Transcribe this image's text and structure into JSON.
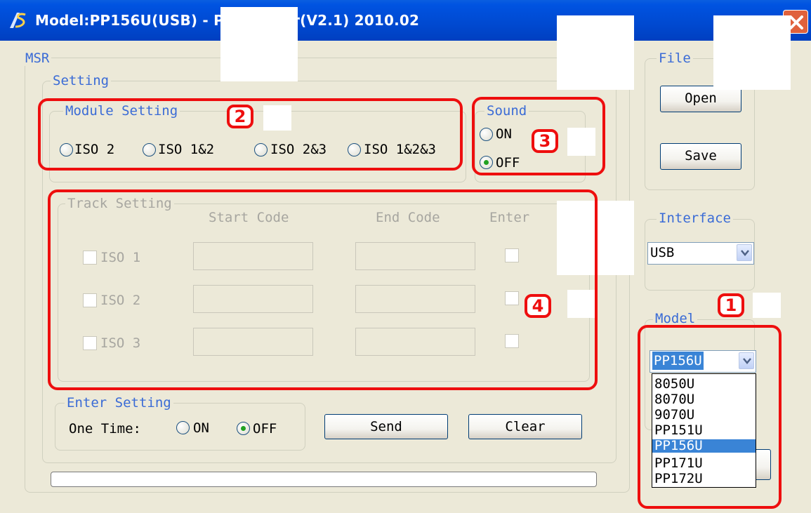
{
  "window": {
    "title": "Model:PP156U(USB) - POS       setter(V2.1) 2010.02"
  },
  "msr": {
    "label": "MSR",
    "setting_label": "Setting",
    "module_setting": {
      "label": "Module Setting",
      "options": [
        "ISO 2",
        "ISO 1&2",
        "ISO 2&3",
        "ISO 1&2&3"
      ]
    },
    "sound": {
      "label": "Sound",
      "on": "ON",
      "off": "OFF",
      "selected": "OFF"
    },
    "track_setting": {
      "label": "Track Setting",
      "headers": [
        "Start Code",
        "End Code",
        "Enter"
      ],
      "tracks": [
        "ISO 1",
        "ISO 2",
        "ISO 3"
      ]
    },
    "enter_setting": {
      "label": "Enter Setting",
      "one_time": "One Time:",
      "on": "ON",
      "off": "OFF",
      "selected": "OFF"
    },
    "send_label": "Send",
    "clear_label": "Clear"
  },
  "file": {
    "label": "File",
    "open_label": "Open",
    "save_label": "Save"
  },
  "interface": {
    "label": "Interface",
    "value": "USB"
  },
  "model": {
    "label": "Model",
    "value": "PP156U",
    "options": [
      "8050U",
      "8070U",
      "9070U",
      "PP151U",
      "PP156U",
      "PP171U",
      "PP172U"
    ],
    "selected_index": 4
  },
  "annotations": {
    "badge1": "1",
    "badge2": "2",
    "badge3": "3",
    "badge4": "4",
    "color": "#ee0e0e"
  },
  "colors": {
    "titlebar": "#0049d0",
    "groupbox_label": "#3a6bd6",
    "window_bg": "#ece9d8"
  }
}
